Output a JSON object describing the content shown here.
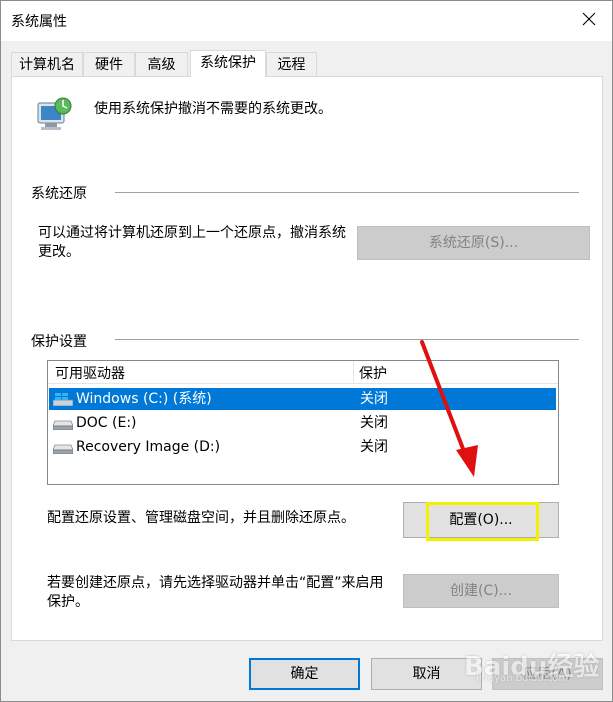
{
  "window": {
    "title": "系统属性"
  },
  "tabs": [
    "计算机名",
    "硬件",
    "高级",
    "系统保护",
    "远程"
  ],
  "intro": {
    "text": "使用系统保护撤消不需要的系统更改。"
  },
  "restore_section": {
    "heading": "系统还原",
    "description": "可以通过将计算机还原到上一个还原点，撤消系统更改。",
    "button": "系统还原(S)..."
  },
  "protection_section": {
    "heading": "保护设置",
    "columns": [
      "可用驱动器",
      "保护"
    ],
    "drives": [
      {
        "name": "Windows (C:) (系统)",
        "protection": "关闭",
        "icon": "windows-drive-icon"
      },
      {
        "name": "DOC (E:)",
        "protection": "关闭",
        "icon": "hard-drive-icon"
      },
      {
        "name": "Recovery Image (D:)",
        "protection": "关闭",
        "icon": "hard-drive-icon"
      }
    ],
    "configure_text": "配置还原设置、管理磁盘空间，并且删除还原点。",
    "configure_button": "配置(O)...",
    "create_text": "若要创建还原点，请先选择驱动器并单击“配置”来启用保护。",
    "create_button": "创建(C)..."
  },
  "footer": {
    "ok": "确定",
    "cancel": "取消",
    "apply": "应用(A)"
  },
  "watermark": {
    "brand": "Baidu经验",
    "url": "jingyan.baidu.com"
  },
  "colors": {
    "selection": "#0078d7",
    "highlight_box": "#f2f200",
    "annotation_arrow": "#e01010",
    "accent_border": "#0078d7"
  }
}
